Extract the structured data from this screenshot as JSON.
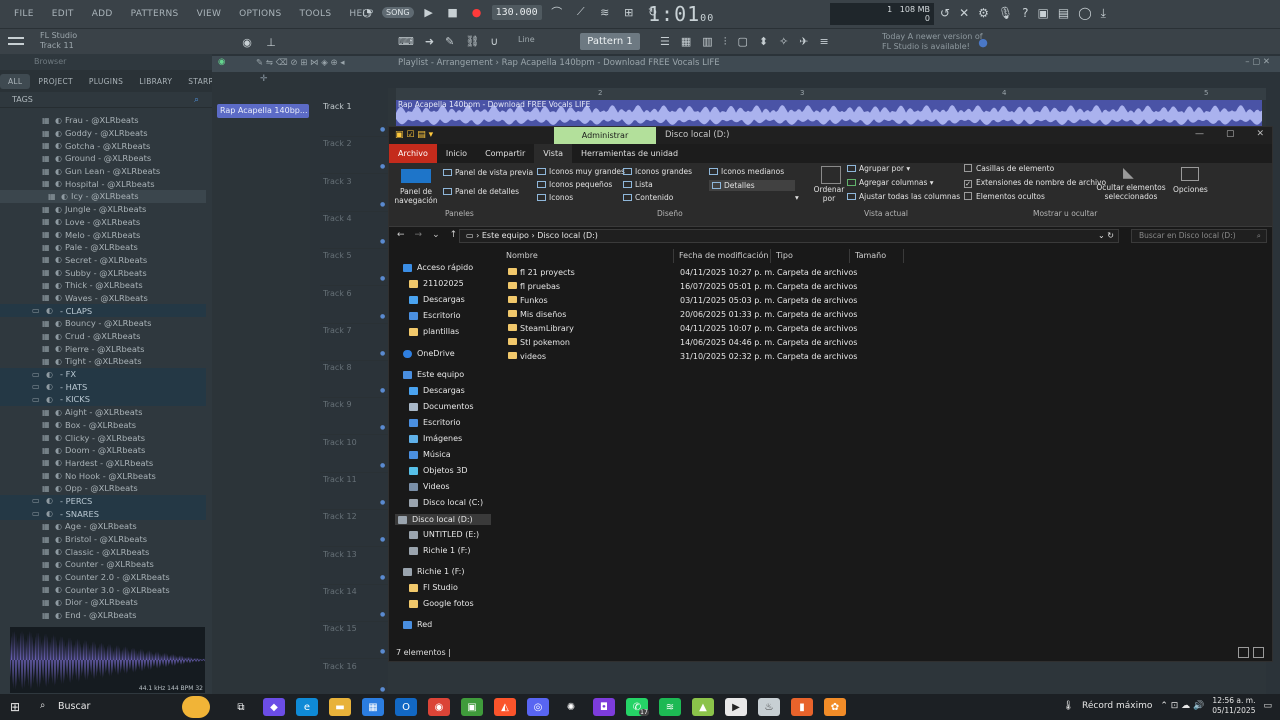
{
  "fl": {
    "menu": [
      "FILE",
      "EDIT",
      "ADD",
      "PATTERNS",
      "VIEW",
      "OPTIONS",
      "TOOLS",
      "HELP"
    ],
    "song_mode": "SONG",
    "tempo": "130.000",
    "time_main": "1:01",
    "time_sub": "00",
    "cpu_mem": "108 MB",
    "cpu_num": "1",
    "cpu_zero": "0",
    "hint_line1": "FL Studio",
    "hint_line2": "Track 11",
    "line_mode": "Line",
    "pattern": "Pattern 1",
    "update_line1": "Today  A newer version of",
    "update_line2": "FL Studio is available!"
  },
  "browser": {
    "title": "Browser",
    "tabs": [
      "ALL",
      "PROJECT",
      "PLUGINS",
      "LIBRARY",
      "STARRED"
    ],
    "tags_label": "TAGS",
    "rows": [
      {
        "label": "Frau - @XLRbeats",
        "type": "file"
      },
      {
        "label": "Goddy - @XLRbeats",
        "type": "file"
      },
      {
        "label": "Gotcha - @XLRbeats",
        "type": "file"
      },
      {
        "label": "Ground - @XLRbeats",
        "type": "file"
      },
      {
        "label": "Gun Lean - @XLRbeats",
        "type": "file"
      },
      {
        "label": "Hospital - @XLRbeats",
        "type": "file"
      },
      {
        "label": "Icy - @XLRbeats",
        "type": "sel"
      },
      {
        "label": "Jungle - @XLRbeats",
        "type": "file"
      },
      {
        "label": "Love - @XLRbeats",
        "type": "file"
      },
      {
        "label": "Melo - @XLRbeats",
        "type": "file"
      },
      {
        "label": "Pale - @XLRbeats",
        "type": "file"
      },
      {
        "label": "Secret - @XLRbeats",
        "type": "file"
      },
      {
        "label": "Subby - @XLRbeats",
        "type": "file"
      },
      {
        "label": "Thick - @XLRbeats",
        "type": "file"
      },
      {
        "label": "Waves - @XLRbeats",
        "type": "file"
      },
      {
        "label": "- CLAPS",
        "type": "folder"
      },
      {
        "label": "Bouncy - @XLRbeats",
        "type": "file"
      },
      {
        "label": "Crud - @XLRbeats",
        "type": "file"
      },
      {
        "label": "Pierre - @XLRbeats",
        "type": "file"
      },
      {
        "label": "Tight - @XLRbeats",
        "type": "file"
      },
      {
        "label": "- FX",
        "type": "folder"
      },
      {
        "label": "- HATS",
        "type": "folder"
      },
      {
        "label": "- KICKS",
        "type": "folder"
      },
      {
        "label": "Aight - @XLRbeats",
        "type": "file"
      },
      {
        "label": "Box - @XLRbeats",
        "type": "file"
      },
      {
        "label": "Clicky - @XLRbeats",
        "type": "file"
      },
      {
        "label": "Doom - @XLRbeats",
        "type": "file"
      },
      {
        "label": "Hardest - @XLRbeats",
        "type": "file"
      },
      {
        "label": "No Hook - @XLRbeats",
        "type": "file"
      },
      {
        "label": "Opp - @XLRbeats",
        "type": "file"
      },
      {
        "label": "- PERCS",
        "type": "folder"
      },
      {
        "label": "- SNARES",
        "type": "folder"
      },
      {
        "label": "Age - @XLRbeats",
        "type": "file"
      },
      {
        "label": "Bristol - @XLRbeats",
        "type": "file"
      },
      {
        "label": "Classic - @XLRbeats",
        "type": "file"
      },
      {
        "label": "Counter - @XLRbeats",
        "type": "file"
      },
      {
        "label": "Counter 2.0 - @XLRbeats",
        "type": "file"
      },
      {
        "label": "Counter 3.0 - @XLRbeats",
        "type": "file"
      },
      {
        "label": "Dior - @XLRbeats",
        "type": "file"
      },
      {
        "label": "End - @XLRbeats",
        "type": "file"
      }
    ],
    "scope_info": "44.1 kHz 144 BPM 32"
  },
  "playlist": {
    "title": "Playlist - Arrangement  ›  Rap Acapella 140bpm - Download FREE Vocals LIFE",
    "picker_item": "Rap Acapella 140bp...",
    "clip_label": "Rap Acapella 140bpm - Download FREE Vocals LIFE",
    "ruler": [
      "2",
      "3",
      "4",
      "5"
    ],
    "tracks": [
      "Track 1",
      "Track 2",
      "Track 3",
      "Track 4",
      "Track 5",
      "Track 6",
      "Track 7",
      "Track 8",
      "Track 9",
      "Track 10",
      "Track 11",
      "Track 12",
      "Track 13",
      "Track 14",
      "Track 15",
      "Track 16"
    ]
  },
  "explorer": {
    "admin_tab": "Administrar",
    "window_title": "Disco local (D:)",
    "tabs": [
      "Archivo",
      "Inicio",
      "Compartir",
      "Vista",
      "Herramientas de unidad"
    ],
    "ribbon": {
      "nav_pane": "Panel de navegación",
      "preview_pane": "Panel de vista previa",
      "details_pane": "Panel de detalles",
      "group_panes": "Paneles",
      "layout": [
        "Iconos muy grandes",
        "Iconos grandes",
        "Iconos medianos",
        "Iconos pequeños",
        "Lista",
        "Detalles",
        "Iconos",
        "Contenido"
      ],
      "group_layout": "Diseño",
      "sort_by": "Ordenar por",
      "group_by": "Agrupar por",
      "add_columns": "Agregar columnas",
      "fit_columns": "Ajustar todas las columnas",
      "group_view": "Vista actual",
      "item_checkboxes": "Casillas de elemento",
      "file_ext": "Extensiones de nombre de archivo",
      "hidden_items": "Elementos ocultos",
      "hide_selected": "Ocultar elementos seleccionados",
      "group_show": "Mostrar u ocultar",
      "options": "Opciones"
    },
    "address": [
      "Este equipo",
      "Disco local (D:)"
    ],
    "search_placeholder": "Buscar en Disco local (D:)",
    "nav": [
      {
        "label": "Acceso rápido",
        "kind": "star"
      },
      {
        "label": "21102025",
        "kind": "folder"
      },
      {
        "label": "Descargas",
        "kind": "down"
      },
      {
        "label": "Escritorio",
        "kind": "blue"
      },
      {
        "label": "plantillas",
        "kind": "folder"
      },
      {
        "label": "OneDrive",
        "kind": "cloud"
      },
      {
        "label": "Este equipo",
        "kind": "pc"
      },
      {
        "label": "Descargas",
        "kind": "down"
      },
      {
        "label": "Documentos",
        "kind": "doc"
      },
      {
        "label": "Escritorio",
        "kind": "blue"
      },
      {
        "label": "Imágenes",
        "kind": "img"
      },
      {
        "label": "Música",
        "kind": "music"
      },
      {
        "label": "Objetos 3D",
        "kind": "obj"
      },
      {
        "label": "Videos",
        "kind": "vid"
      },
      {
        "label": "Disco local (C:)",
        "kind": "drive"
      },
      {
        "label": "Disco local (D:)",
        "kind": "drive"
      },
      {
        "label": "UNTITLED (E:)",
        "kind": "drive"
      },
      {
        "label": "Richie 1 (F:)",
        "kind": "drive"
      },
      {
        "label": "Richie 1 (F:)",
        "kind": "drive"
      },
      {
        "label": "Fl Studio",
        "kind": "folder"
      },
      {
        "label": "Google fotos",
        "kind": "folder"
      },
      {
        "label": "Red",
        "kind": "net"
      }
    ],
    "columns": [
      "Nombre",
      "Fecha de modificación",
      "Tipo",
      "Tamaño"
    ],
    "files": [
      {
        "name": "fl 21 proyects",
        "date": "04/11/2025 10:27 p. m.",
        "type": "Carpeta de archivos"
      },
      {
        "name": "fl pruebas",
        "date": "16/07/2025 05:01 p. m.",
        "type": "Carpeta de archivos"
      },
      {
        "name": "Funkos",
        "date": "03/11/2025 05:03 p. m.",
        "type": "Carpeta de archivos"
      },
      {
        "name": "Mis diseños",
        "date": "20/06/2025 01:33 p. m.",
        "type": "Carpeta de archivos"
      },
      {
        "name": "SteamLibrary",
        "date": "04/11/2025 10:07 p. m.",
        "type": "Carpeta de archivos"
      },
      {
        "name": "Stl pokemon",
        "date": "14/06/2025 04:46 p. m.",
        "type": "Carpeta de archivos"
      },
      {
        "name": "videos",
        "date": "31/10/2025 02:32 p. m.",
        "type": "Carpeta de archivos"
      }
    ],
    "status": "7 elementos"
  },
  "taskbar": {
    "search": "Buscar",
    "weather": "Récord máximo",
    "time": "12:56 a. m.",
    "date": "05/11/2025",
    "whatsapp_badge": "17"
  }
}
